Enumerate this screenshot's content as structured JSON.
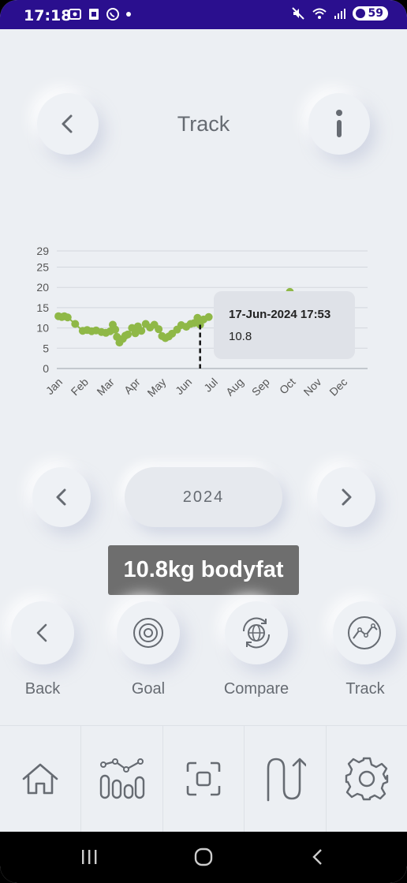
{
  "status_bar": {
    "time": "17:18",
    "battery": "59"
  },
  "header": {
    "title": "Track",
    "back_icon": "chevron-left-icon",
    "info_icon": "info-icon"
  },
  "chart_data": {
    "type": "scatter",
    "title": "",
    "xlabel": "",
    "ylabel": "",
    "x_tick_labels": [
      "Jan",
      "Feb",
      "Mar",
      "Apr",
      "May",
      "Jun",
      "Jul",
      "Aug",
      "Sep",
      "Oct",
      "Nov",
      "Dec"
    ],
    "y_tick_labels": [
      "0",
      "5",
      "10",
      "15",
      "20",
      "25",
      "29"
    ],
    "y_ticks": [
      0,
      5,
      10,
      15,
      20,
      25,
      29
    ],
    "ylim": [
      0,
      29
    ],
    "grid": true,
    "series_color": "#8fb847",
    "points": [
      {
        "x": "2024-01-03",
        "y": 12.9
      },
      {
        "x": "2024-01-07",
        "y": 12.7
      },
      {
        "x": "2024-01-10",
        "y": 12.9
      },
      {
        "x": "2024-01-14",
        "y": 12.6
      },
      {
        "x": "2024-01-23",
        "y": 11.0
      },
      {
        "x": "2024-02-01",
        "y": 9.3
      },
      {
        "x": "2024-02-06",
        "y": 9.5
      },
      {
        "x": "2024-02-11",
        "y": 9.2
      },
      {
        "x": "2024-02-16",
        "y": 9.4
      },
      {
        "x": "2024-02-22",
        "y": 9.0
      },
      {
        "x": "2024-02-27",
        "y": 8.8
      },
      {
        "x": "2024-03-03",
        "y": 9.2
      },
      {
        "x": "2024-03-06",
        "y": 10.8
      },
      {
        "x": "2024-03-09",
        "y": 9.6
      },
      {
        "x": "2024-03-11",
        "y": 7.8
      },
      {
        "x": "2024-03-14",
        "y": 6.4
      },
      {
        "x": "2024-03-18",
        "y": 7.3
      },
      {
        "x": "2024-03-21",
        "y": 8.1
      },
      {
        "x": "2024-03-24",
        "y": 8.4
      },
      {
        "x": "2024-03-29",
        "y": 10.0
      },
      {
        "x": "2024-04-02",
        "y": 8.7
      },
      {
        "x": "2024-04-05",
        "y": 10.4
      },
      {
        "x": "2024-04-09",
        "y": 9.3
      },
      {
        "x": "2024-04-14",
        "y": 11.0
      },
      {
        "x": "2024-04-19",
        "y": 10.1
      },
      {
        "x": "2024-04-24",
        "y": 10.8
      },
      {
        "x": "2024-04-29",
        "y": 9.7
      },
      {
        "x": "2024-05-03",
        "y": 8.0
      },
      {
        "x": "2024-05-07",
        "y": 7.5
      },
      {
        "x": "2024-05-11",
        "y": 7.9
      },
      {
        "x": "2024-05-15",
        "y": 8.6
      },
      {
        "x": "2024-05-21",
        "y": 9.6
      },
      {
        "x": "2024-05-26",
        "y": 10.7
      },
      {
        "x": "2024-06-01",
        "y": 10.3
      },
      {
        "x": "2024-06-06",
        "y": 11.0
      },
      {
        "x": "2024-06-10",
        "y": 11.2
      },
      {
        "x": "2024-06-14",
        "y": 12.5
      },
      {
        "x": "2024-06-17",
        "y": 10.8
      },
      {
        "x": "2024-06-21",
        "y": 12.1
      },
      {
        "x": "2024-06-27",
        "y": 12.7
      },
      {
        "x": "2024-10-01",
        "y": 18.9
      }
    ],
    "selected": {
      "date": "17-Jun-2024 17:53",
      "value": "10.8"
    }
  },
  "year_selector": {
    "year": "2024",
    "prev_icon": "chevron-left-icon",
    "next_icon": "chevron-right-icon"
  },
  "result_badge": "10.8kg bodyfat",
  "actions": [
    {
      "label": "Back",
      "icon": "chevron-left-icon"
    },
    {
      "label": "Goal",
      "icon": "target-icon"
    },
    {
      "label": "Compare",
      "icon": "globe-sync-icon"
    },
    {
      "label": "Track",
      "icon": "chart-line-icon"
    }
  ],
  "tabs": [
    {
      "name": "home",
      "icon": "home-icon"
    },
    {
      "name": "stats",
      "icon": "bar-chart-icon"
    },
    {
      "name": "scan",
      "icon": "scan-icon"
    },
    {
      "name": "progress",
      "icon": "path-icon"
    },
    {
      "name": "settings",
      "icon": "gear-icon"
    }
  ]
}
